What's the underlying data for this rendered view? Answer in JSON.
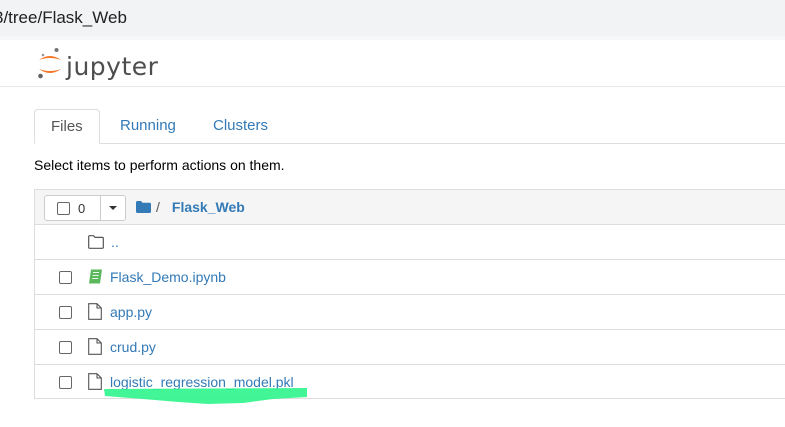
{
  "browser": {
    "url": "3/tree/Flask_Web"
  },
  "header": {
    "logo_text": "jupyter"
  },
  "tabs": [
    {
      "label": "Files",
      "active": true
    },
    {
      "label": "Running",
      "active": false
    },
    {
      "label": "Clusters",
      "active": false
    }
  ],
  "hint": "Select items to perform actions on them.",
  "toolbar": {
    "selected_count": "0",
    "breadcrumb_sep": "/",
    "current_dir": "Flask_Web"
  },
  "files": [
    {
      "name": "..",
      "type": "folder-up"
    },
    {
      "name": "Flask_Demo.ipynb",
      "type": "notebook"
    },
    {
      "name": "app.py",
      "type": "file"
    },
    {
      "name": "crud.py",
      "type": "file"
    },
    {
      "name": "logistic_regression_model.pkl",
      "type": "file",
      "highlighted": true
    }
  ],
  "colors": {
    "link": "#337ab7",
    "notebook_icon": "#5cb85c",
    "highlight": "#2df58c",
    "logo_orange": "#f37726"
  }
}
